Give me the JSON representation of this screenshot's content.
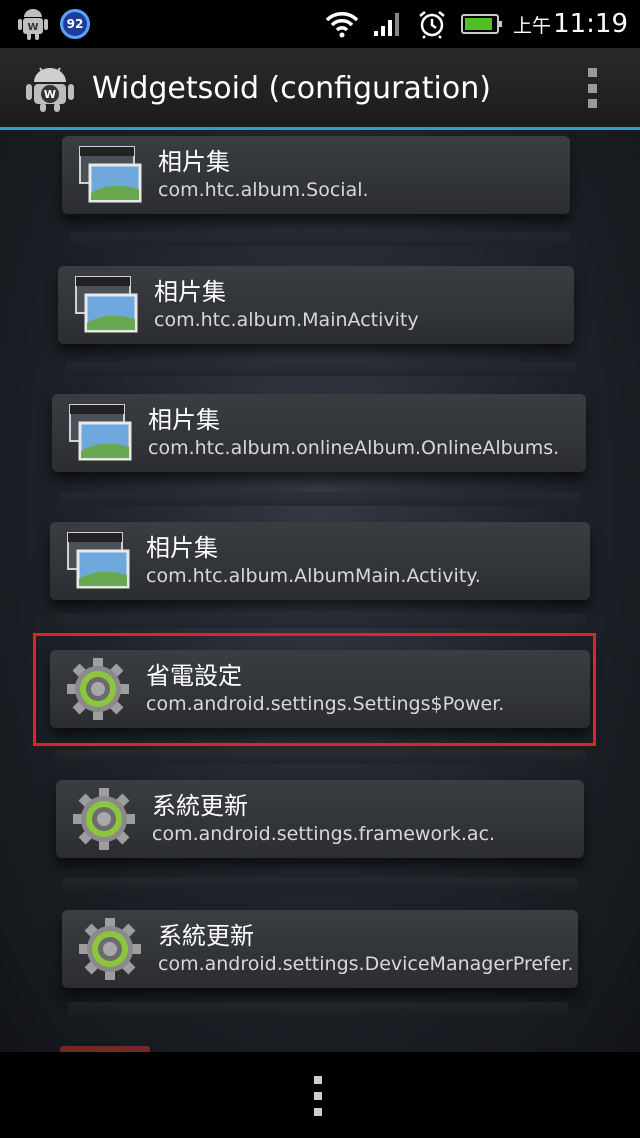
{
  "status_bar": {
    "notification_badge": "92",
    "ampm": "上午",
    "time": "11:19",
    "battery_level": 0.9,
    "icons": [
      "android-robot-icon",
      "wifi-icon",
      "signal-icon",
      "alarm-icon",
      "battery-icon"
    ]
  },
  "action_bar": {
    "title": "Widgetsoid (configuration)",
    "app_icon": "widgetsoid-robot-icon",
    "overflow_icon": "overflow-menu-icon"
  },
  "list": {
    "items": [
      {
        "name": "相片集",
        "package": "com.htc.album.Social.",
        "icon": "album-icon"
      },
      {
        "name": "相片集",
        "package": "com.htc.album.MainActivity",
        "icon": "album-icon"
      },
      {
        "name": "相片集",
        "package": "com.htc.album.onlineAlbum.OnlineAlbums.",
        "icon": "album-icon"
      },
      {
        "name": "相片集",
        "package": "com.htc.album.AlbumMain.Activity.",
        "icon": "album-icon"
      },
      {
        "name": "省電設定",
        "package": "com.android.settings.Settings$Power.",
        "icon": "settings-gear-icon",
        "highlighted": true
      },
      {
        "name": "系統更新",
        "package": "com.android.settings.framework.ac.",
        "icon": "settings-gear-icon"
      },
      {
        "name": "系統更新",
        "package": "com.android.settings.DeviceManagerPrefer.",
        "icon": "settings-gear-icon"
      }
    ],
    "highlight_color": "#e0222a"
  },
  "colors": {
    "accent_line": "#2d9fd8",
    "gear_green": "#8cc63f"
  },
  "nav_bar": {
    "menu_icon": "menu-dots-icon"
  }
}
